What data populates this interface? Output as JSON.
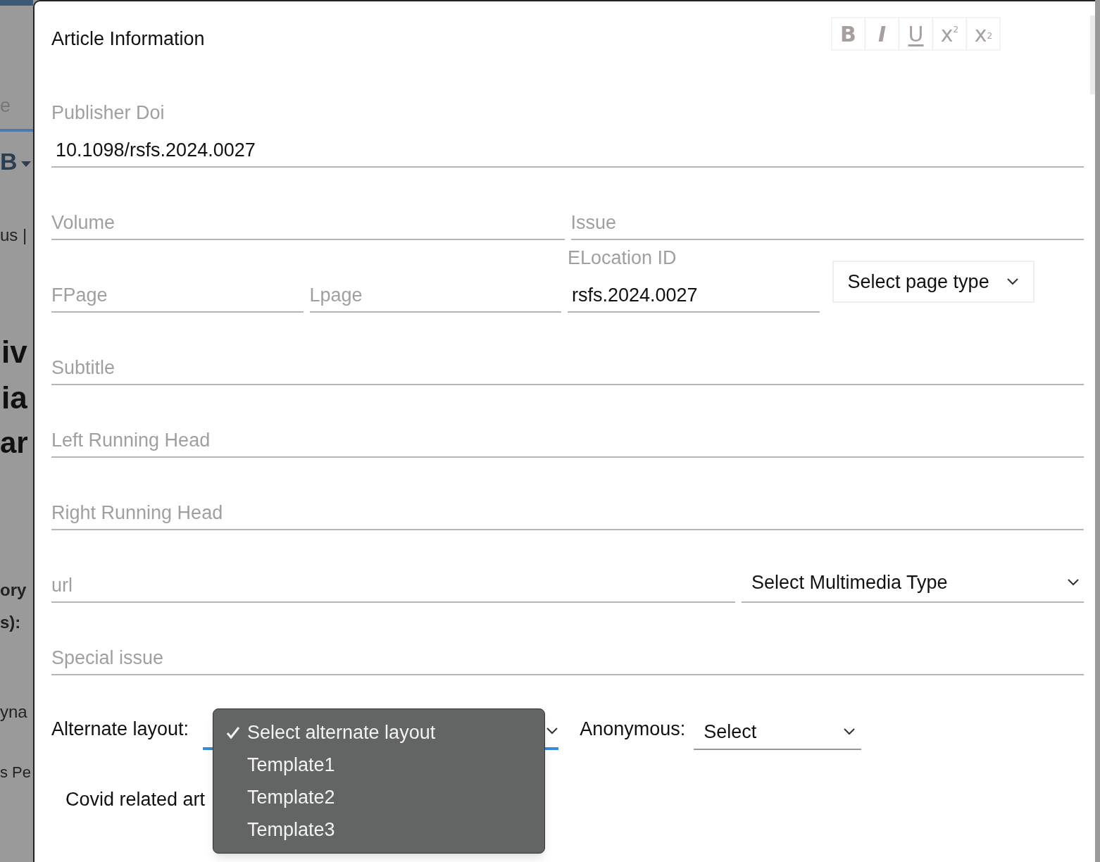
{
  "background_fragments": [
    "e",
    "B",
    "us |",
    "iv",
    "ia",
    "ar",
    "ory",
    "s):",
    "yna",
    "s Pe"
  ],
  "dialog": {
    "title": "Article Information",
    "toolbar": [
      {
        "kind": "bold",
        "label": "B"
      },
      {
        "kind": "italic",
        "label": "I"
      },
      {
        "kind": "underline",
        "label": "U"
      },
      {
        "kind": "superscript",
        "label": "x",
        "mark": "2"
      },
      {
        "kind": "subscript",
        "label": "x",
        "mark": "2"
      }
    ],
    "fields": [
      {
        "kind": "input",
        "label": "Publisher Doi",
        "value": "10.1098/rsfs.2024.0027"
      },
      {
        "kind": "input",
        "placeholder": "Volume"
      },
      {
        "kind": "input",
        "placeholder": "Issue"
      },
      {
        "kind": "input",
        "placeholder": "FPage"
      },
      {
        "kind": "input",
        "placeholder": "Lpage"
      },
      {
        "kind": "input",
        "label": "ELocation ID",
        "value": "rsfs.2024.0027"
      },
      {
        "kind": "button_select",
        "value": "Select page type"
      },
      {
        "kind": "input",
        "placeholder": "Subtitle"
      },
      {
        "kind": "input",
        "placeholder": "Left Running Head"
      },
      {
        "kind": "input",
        "placeholder": "Right Running Head"
      },
      {
        "kind": "input",
        "placeholder": "url"
      },
      {
        "kind": "line_select",
        "value": "Select Multimedia Type"
      },
      {
        "kind": "input",
        "placeholder": "Special issue"
      }
    ],
    "alternate_layout": {
      "label": "Alternate layout:",
      "options": [
        {
          "text": "Select alternate layout",
          "selected": true
        },
        {
          "text": "Template1",
          "selected": false
        },
        {
          "text": "Template2",
          "selected": false
        },
        {
          "text": "Template3",
          "selected": false
        }
      ]
    },
    "anonymous": {
      "label": "Anonymous:",
      "value": "Select"
    },
    "covid": {
      "label": "Covid related art"
    }
  }
}
